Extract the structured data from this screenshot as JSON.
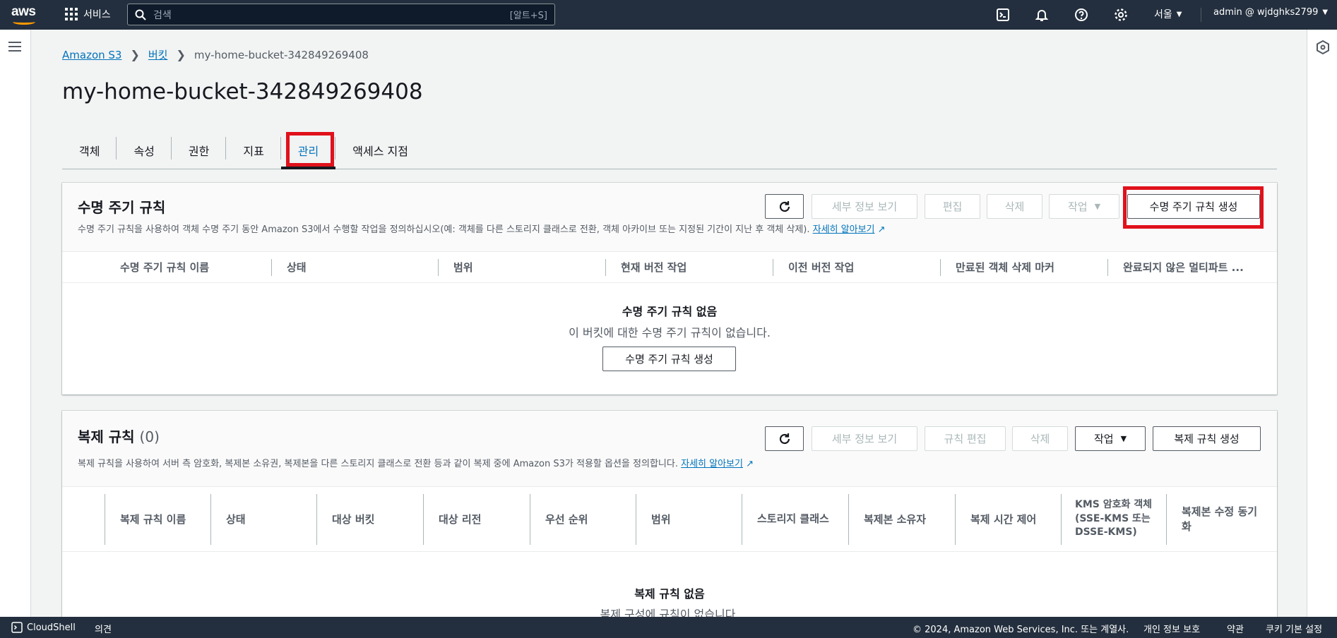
{
  "topnav": {
    "logo_text": "aws",
    "services_label": "서비스",
    "search_placeholder": "검색",
    "search_shortcut": "[알트+S]",
    "region": "서울",
    "account": "admin @ wjdghks2799"
  },
  "breadcrumb": {
    "root": "Amazon S3",
    "buckets": "버킷",
    "current": "my-home-bucket-342849269408"
  },
  "page_title": "my-home-bucket-342849269408",
  "tabs": [
    {
      "label": "객체"
    },
    {
      "label": "속성"
    },
    {
      "label": "권한"
    },
    {
      "label": "지표"
    },
    {
      "label": "관리",
      "active": true
    },
    {
      "label": "액세스 지점"
    }
  ],
  "lifecycle": {
    "title": "수명 주기 규칙",
    "description": "수명 주기 규칙을 사용하여 객체 수명 주기 동안 Amazon S3에서 수행할 작업을 정의하십시오(예: 객체를 다른 스토리지 클래스로 전환, 객체 아카이브 또는 지정된 기간이 지난 후 객체 삭제).",
    "learn_more": "자세히 알아보기",
    "buttons": {
      "view_details": "세부 정보 보기",
      "edit": "편집",
      "delete": "삭제",
      "actions": "작업",
      "create": "수명 주기 규칙 생성"
    },
    "columns": [
      "수명 주기 규칙 이름",
      "상태",
      "범위",
      "현재 버전 작업",
      "이전 버전 작업",
      "만료된 객체 삭제 마커",
      "완료되지 않은 멀티파트 ..."
    ],
    "empty_title": "수명 주기 규칙 없음",
    "empty_sub": "이 버킷에 대한 수명 주기 규칙이 없습니다.",
    "empty_button": "수명 주기 규칙 생성"
  },
  "replication": {
    "title": "복제 규칙",
    "count": "(0)",
    "description": "복제 규칙을 사용하여 서버 측 암호화, 복제본 소유권, 복제본을 다른 스토리지 클래스로 전환 등과 같이 복제 중에 Amazon S3가 적용할 옵션을 정의합니다.",
    "learn_more": "자세히 알아보기",
    "buttons": {
      "view_details": "세부 정보 보기",
      "edit_rule": "규칙 편집",
      "delete": "삭제",
      "actions": "작업",
      "create": "복제 규칙 생성"
    },
    "columns": [
      "복제 규칙 이름",
      "상태",
      "대상 버킷",
      "대상 리전",
      "우선 순위",
      "범위",
      "스토리지 클래스",
      "복제본 소유자",
      "복제 시간 제어",
      "KMS 암호화 객체(SSE-KMS 또는 DSSE-KMS)",
      "복제본 수정 동기화"
    ],
    "empty_title": "복제 규칙 없음",
    "empty_sub": "복제 구성에 규칙이 없습니다."
  },
  "footer": {
    "cloudshell": "CloudShell",
    "feedback": "의견",
    "copyright": "© 2024, Amazon Web Services, Inc. 또는 계열사.",
    "privacy": "개인 정보 보호",
    "terms": "약관",
    "cookies": "쿠키 기본 설정"
  },
  "colors": {
    "nav_bg": "#232f3e",
    "link": "#0073bb",
    "highlight": "#e0111b",
    "aws_orange": "#ff9900"
  }
}
